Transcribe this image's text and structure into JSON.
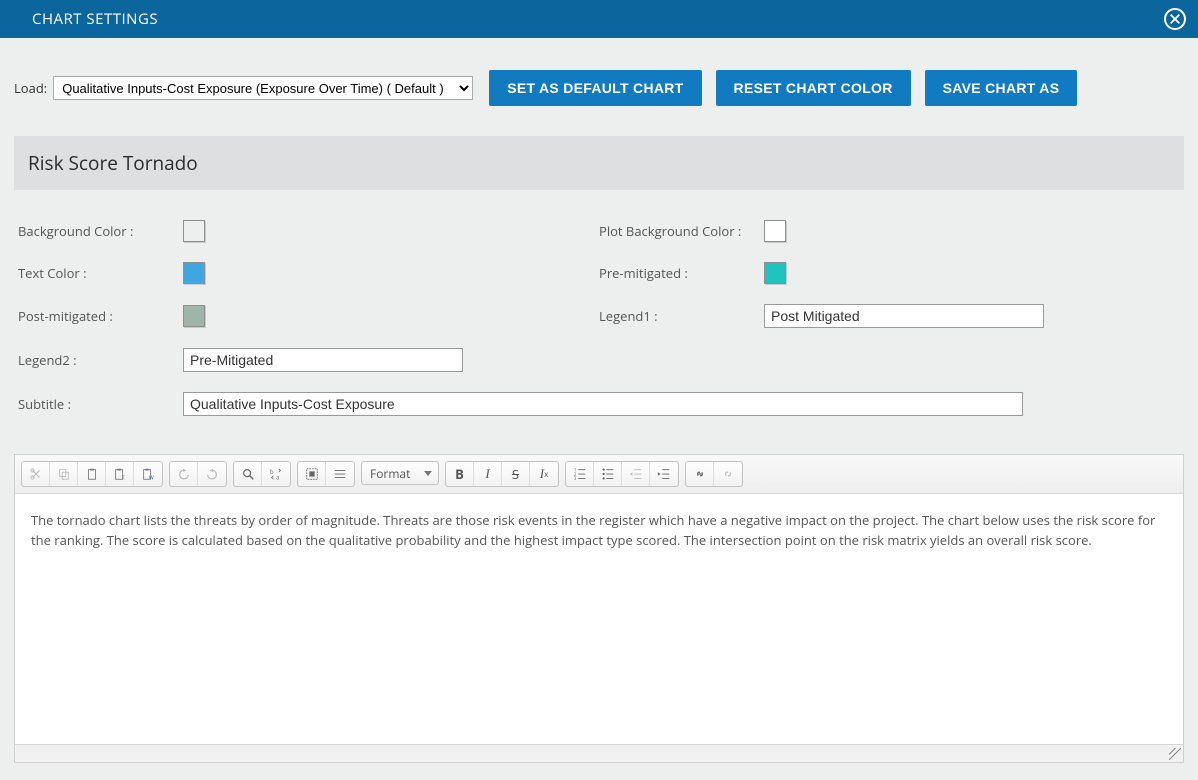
{
  "header": {
    "title": "CHART SETTINGS"
  },
  "top": {
    "load_label": "Load:",
    "load_selected": "Qualitative Inputs-Cost Exposure (Exposure Over Time) ( Default )",
    "btn_default": "SET AS DEFAULT CHART",
    "btn_reset": "RESET CHART COLOR",
    "btn_saveas": "SAVE CHART AS"
  },
  "section": {
    "title": "Risk Score Tornado"
  },
  "fields": {
    "background_color_label": "Background Color :",
    "background_color": "#e6f7f7",
    "plot_bg_label": "Plot Background Color :",
    "plot_bg_color": "#ffffff",
    "text_color_label": "Text Color :",
    "text_color": "#3fa6e0",
    "pre_mitigated_label": "Pre-mitigated :",
    "pre_mitigated_color": "#1fc3c0",
    "post_mitigated_label": "Post-mitigated :",
    "post_mitigated_color": "#9fb5aa",
    "legend1_label": "Legend1 :",
    "legend1_value": "Post Mitigated",
    "legend2_label": "Legend2 :",
    "legend2_value": "Pre-Mitigated",
    "subtitle_label": "Subtitle :",
    "subtitle_value": "Qualitative Inputs-Cost Exposure"
  },
  "editor": {
    "format_label": "Format",
    "body_text": "The tornado chart lists the threats by order of magnitude. Threats are those risk events in the register which have a negative impact on the project. The chart below uses the risk score for the ranking. The score is calculated based on the qualitative probability and the highest impact type scored. The intersection point on the risk matrix yields an overall risk score."
  }
}
